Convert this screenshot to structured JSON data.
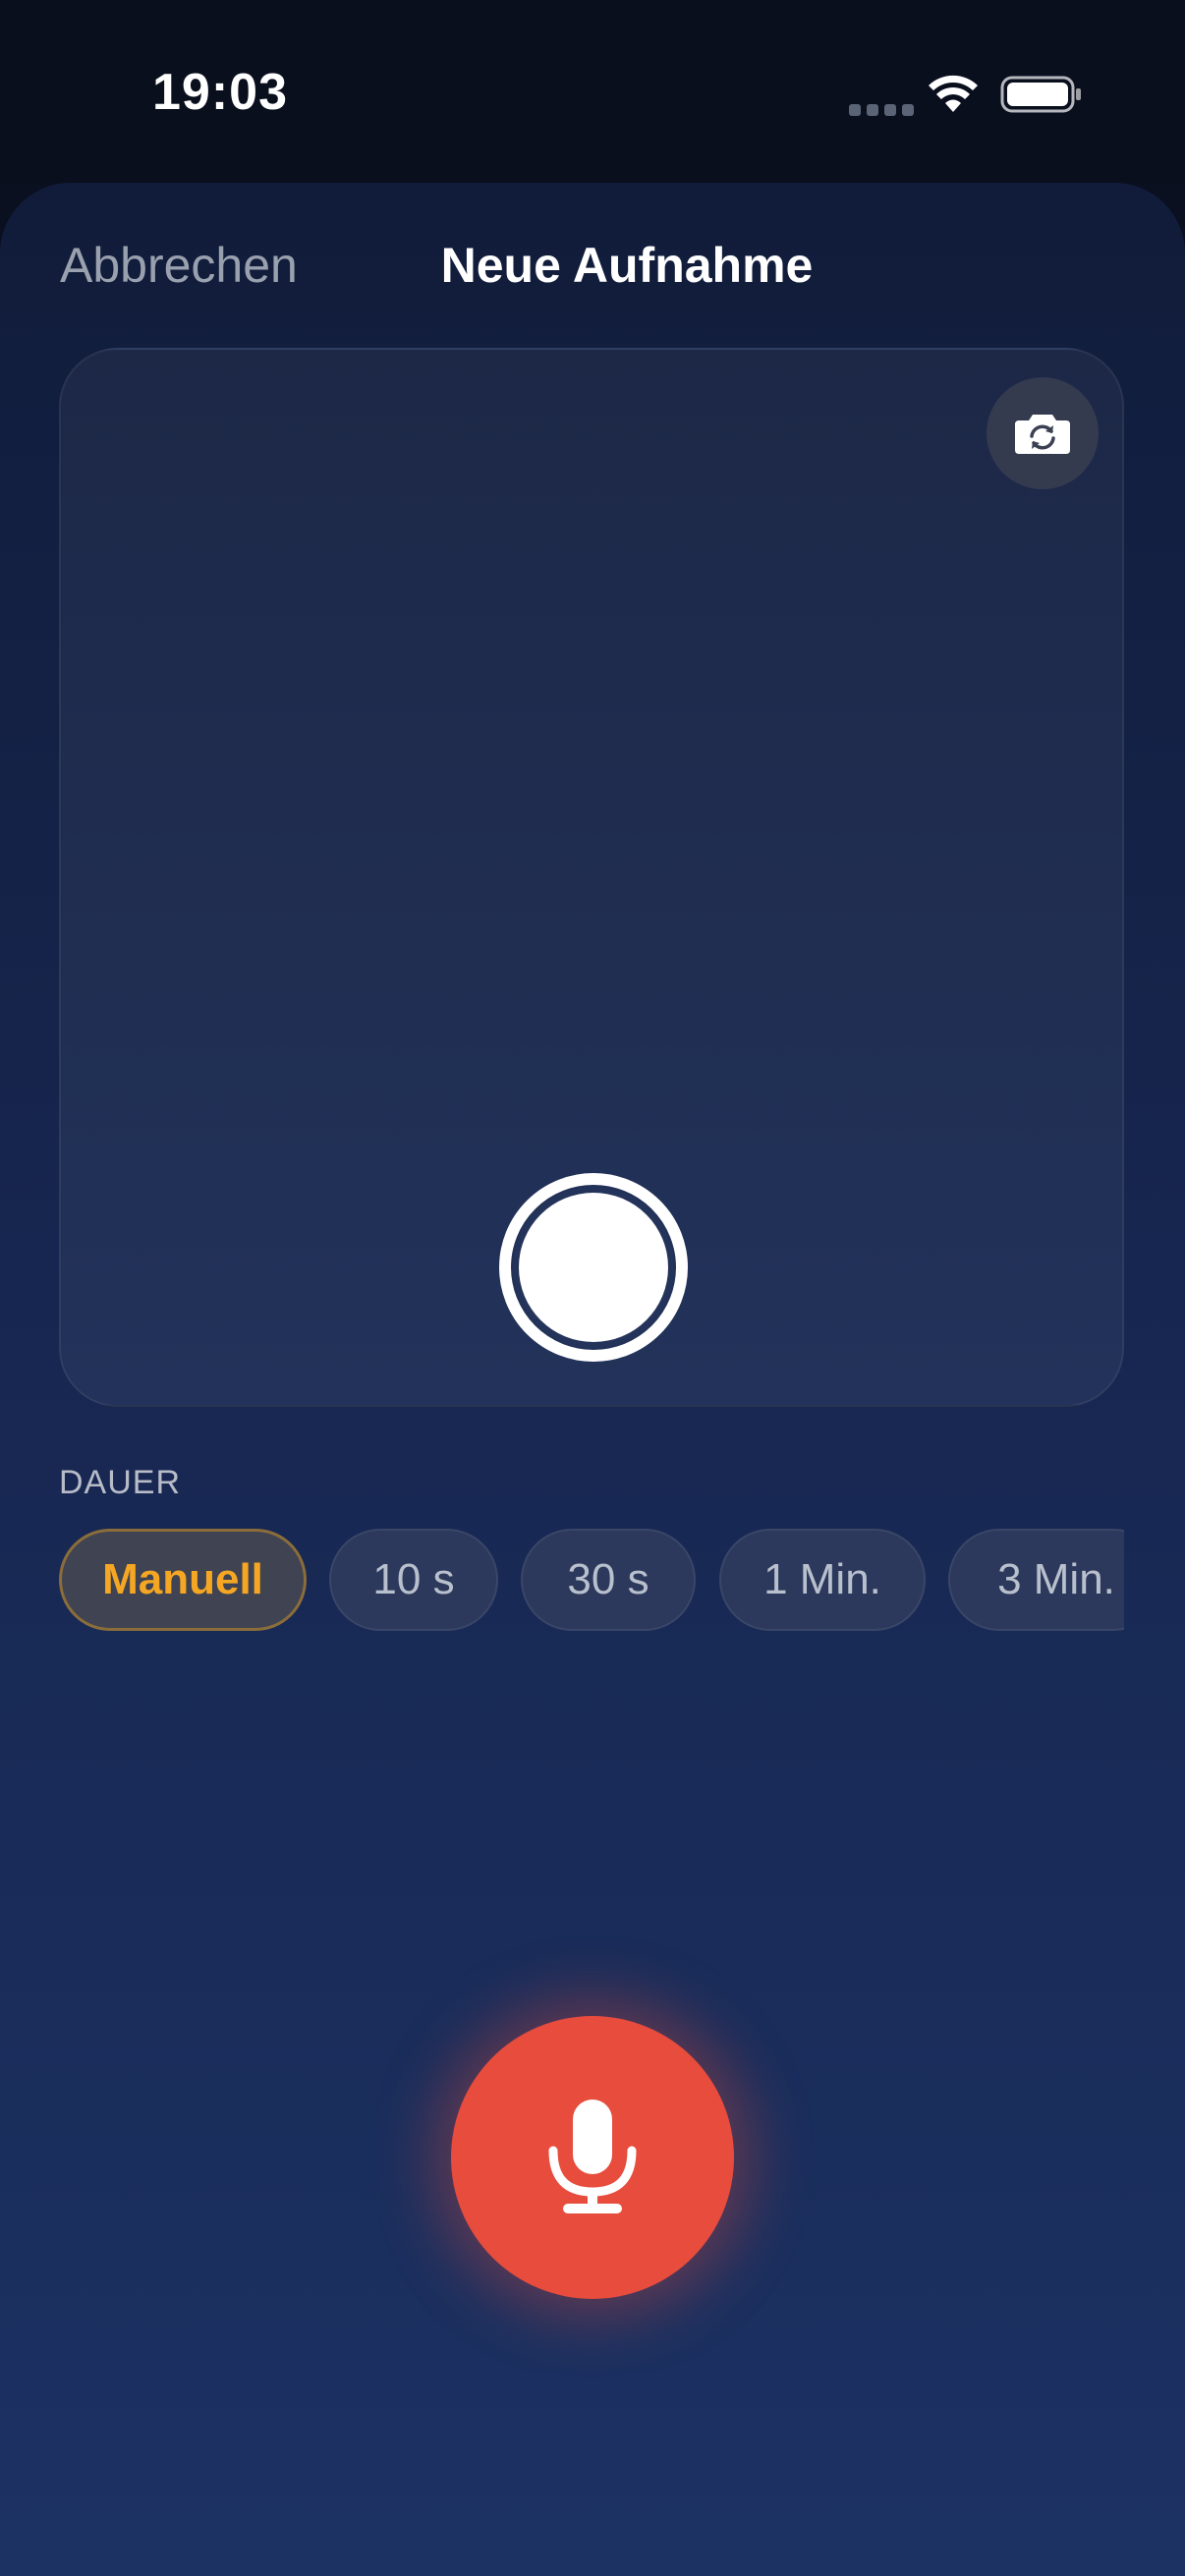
{
  "status_bar": {
    "time": "19:03",
    "icons": [
      "cellular-dots-icon",
      "wifi-icon",
      "battery-icon"
    ]
  },
  "header": {
    "cancel_label": "Abbrechen",
    "title": "Neue Aufnahme"
  },
  "camera": {
    "flip_icon": "camera-flip-icon",
    "shutter_icon": "shutter-icon"
  },
  "duration": {
    "label": "DAUER",
    "options": [
      "Manuell",
      "10 s",
      "30 s",
      "1 Min.",
      "3 Min."
    ],
    "selected": "Manuell"
  },
  "record": {
    "icon": "microphone-icon"
  },
  "colors": {
    "accent": "#f5a623",
    "record": "#e74c3c",
    "background_top": "#111c3a",
    "background_bottom": "#1c3263"
  }
}
